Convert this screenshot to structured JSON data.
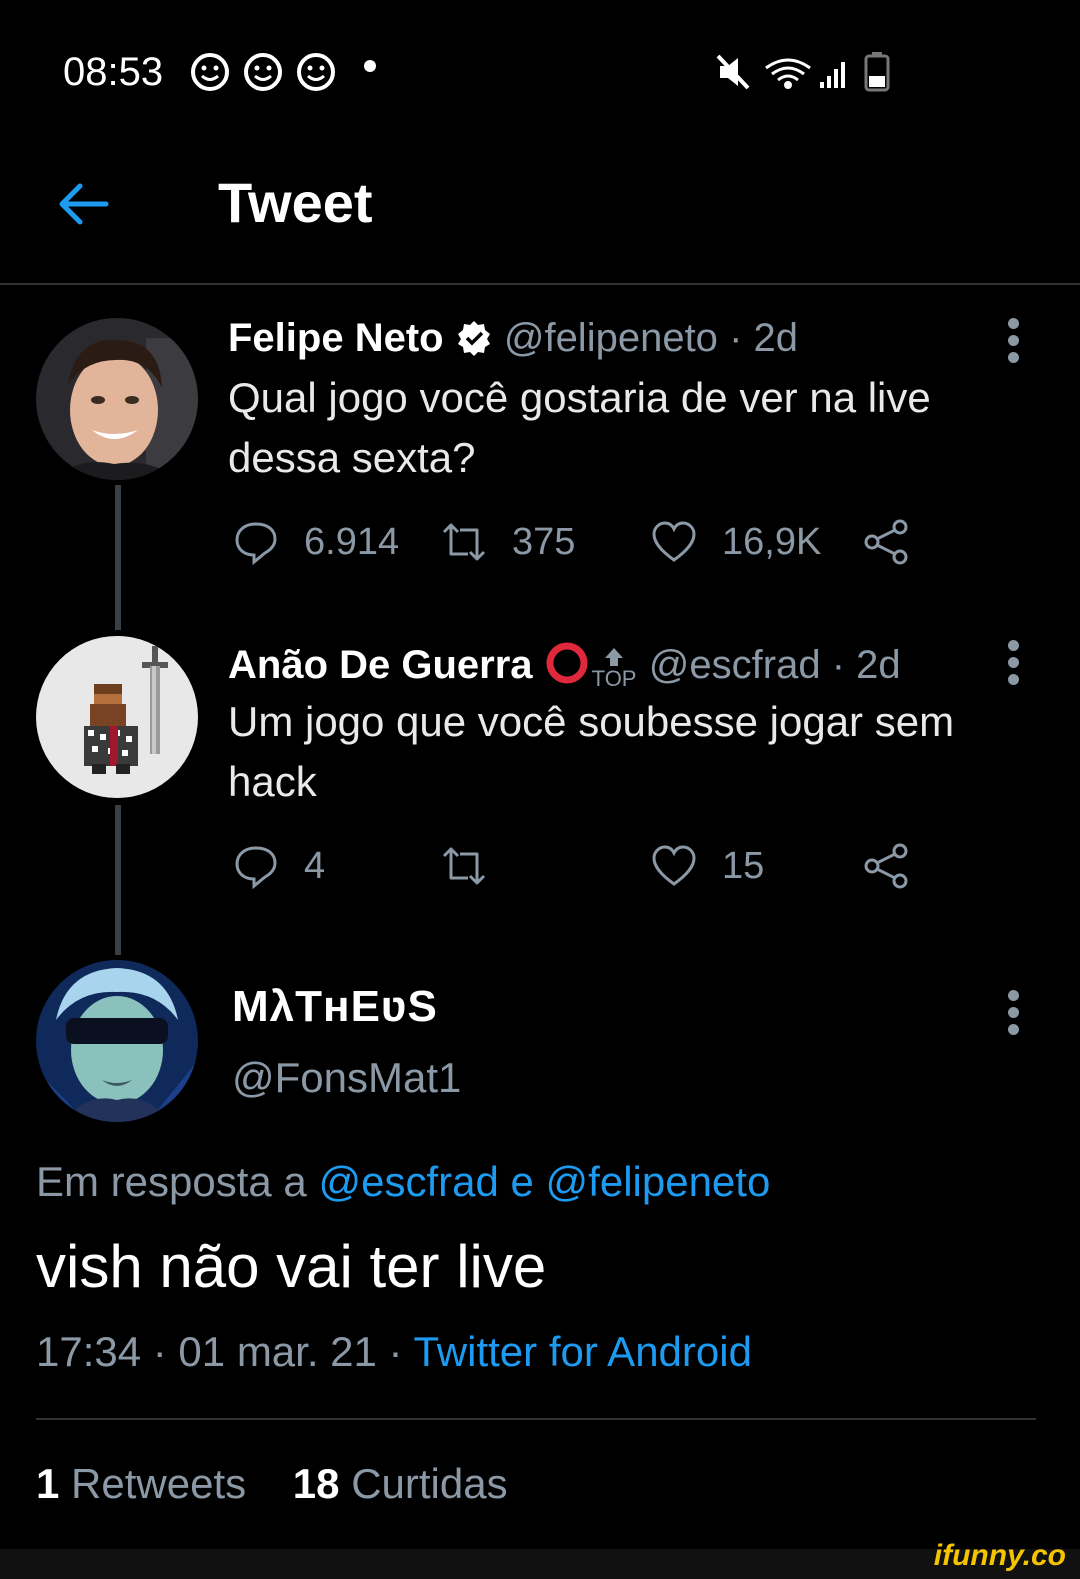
{
  "status_bar": {
    "time": "08:53",
    "emoji_icons": [
      "smiley-icon",
      "smiley-icon",
      "smiley-icon"
    ],
    "right_icons": [
      "mute-icon",
      "wifi-icon",
      "signal-icon",
      "battery-icon"
    ]
  },
  "header": {
    "title": "Tweet",
    "back_icon": "arrow-left-icon"
  },
  "tweets": [
    {
      "name": "Felipe Neto",
      "verified": true,
      "handle": "@felipeneto",
      "time": "· 2d",
      "text": "Qual jogo você gostaria de ver na live dessa sexta?",
      "replies": "6.914",
      "retweets": "375",
      "likes": "16,9K"
    },
    {
      "name": "Anão De Guerra",
      "badge_text": "TOP",
      "handle": "@escfrad",
      "time": "· 2d",
      "text": "Um jogo que você soubesse jogar sem hack",
      "replies": "4",
      "retweets": "",
      "likes": "15"
    }
  ],
  "reply": {
    "name": "MλTнEʋS",
    "handle": "@FonsMat1",
    "reply_prefix": "Em resposta a",
    "reply_users": "@escfrad e @felipeneto",
    "text": "vish não vai ter live",
    "timestamp": "17:34 · 01 mar. 21 ·",
    "source": "Twitter for Android",
    "retweets_count": "1",
    "retweets_label": "Retweets",
    "likes_count": "18",
    "likes_label": "Curtidas"
  },
  "watermark": "ifunny.co",
  "colors": {
    "background": "#000000",
    "link": "#1d9bf0",
    "muted": "#8b98a5",
    "verified": "#ffffff"
  }
}
